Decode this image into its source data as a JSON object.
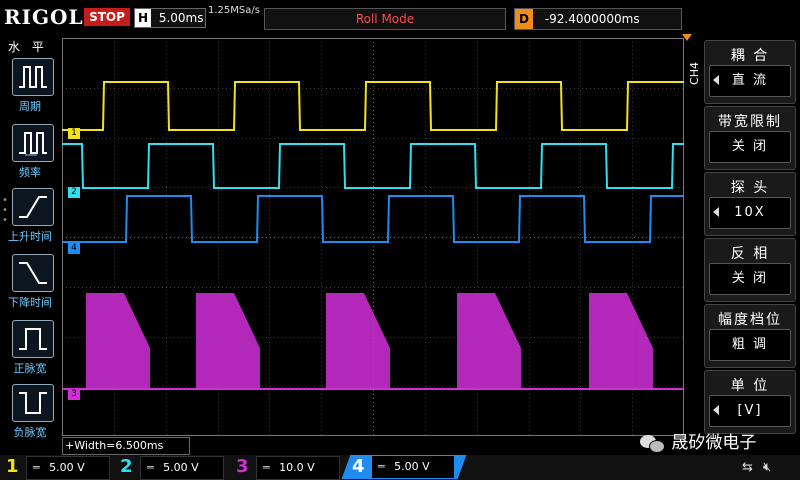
{
  "top": {
    "logo": "RIGOL",
    "run_state": "STOP",
    "timebase_label": "H",
    "timebase": "5.00ms",
    "sample_rate": "1.25MSa/s",
    "mode": "Roll Mode",
    "delay_label": "D",
    "delay": "-92.4000000ms"
  },
  "left_panel": {
    "title": "水 平",
    "items": [
      {
        "label": "周期",
        "icon": "period-icon"
      },
      {
        "label": "频率",
        "icon": "frequency-icon"
      },
      {
        "label": "上升时间",
        "icon": "rise-time-icon"
      },
      {
        "label": "下降时间",
        "icon": "fall-time-icon"
      },
      {
        "label": "正脉宽",
        "icon": "positive-pulse-icon"
      },
      {
        "label": "负脉宽",
        "icon": "negative-pulse-icon"
      }
    ]
  },
  "right_panel": {
    "channel": "CH4",
    "menus": [
      {
        "title": "耦 合",
        "value": "直 流"
      },
      {
        "title": "带宽限制",
        "value": "关 闭"
      },
      {
        "title": "探 头",
        "value": "10X"
      },
      {
        "title": "反 相",
        "value": "关 闭"
      },
      {
        "title": "幅度档位",
        "value": "粗 调"
      },
      {
        "title": "单 位",
        "value": "[V]"
      }
    ]
  },
  "channel_markers": [
    "1",
    "2",
    "4",
    "3"
  ],
  "measurement": "+Width=6.500ms",
  "channels": [
    {
      "num": "1",
      "scale": "5.00 V",
      "color": "#f2e21a"
    },
    {
      "num": "2",
      "scale": "5.00 V",
      "color": "#2fe0f0"
    },
    {
      "num": "3",
      "scale": "10.0 V",
      "color": "#d12fd8"
    },
    {
      "num": "4",
      "scale": "5.00 V",
      "color": "#1f8cf0"
    }
  ],
  "watermark": "晟矽微电子",
  "status_icons": [
    "usb-icon",
    "mute-icon"
  ]
}
